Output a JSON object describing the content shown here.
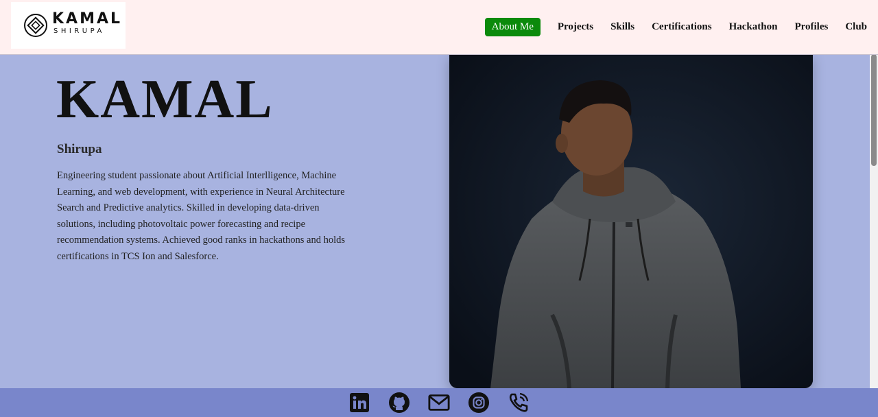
{
  "brand": {
    "name": "KAMAL",
    "tagline": "SHIRUPA",
    "emblem_icon": "diamond-emblem-icon"
  },
  "nav": {
    "items": [
      {
        "label": "About Me",
        "active": true
      },
      {
        "label": "Projects",
        "active": false
      },
      {
        "label": "Skills",
        "active": false
      },
      {
        "label": "Certifications",
        "active": false
      },
      {
        "label": "Hackathon",
        "active": false
      },
      {
        "label": "Profiles",
        "active": false
      },
      {
        "label": "Club",
        "active": false
      }
    ],
    "active_color": "#0b8a0b"
  },
  "hero": {
    "title": "KAMAL",
    "subtitle": "Shirupa",
    "description": "Engineering student passionate about Artificial Interlligence, Machine Learning, and web development, with experience in Neural Architecture Search and Predictive analytics. Skilled in developing data-driven solutions, including photovoltaic power forecasting and recipe recommendation systems. Achieved good ranks in hackathons and holds certifications in TCS Ion and Salesforce."
  },
  "footer": {
    "social_icons": [
      "linkedin-icon",
      "github-icon",
      "mail-icon",
      "instagram-icon",
      "phone-icon"
    ]
  },
  "colors": {
    "header_bg": "#fff0f0",
    "page_bg": "#a8b3e0",
    "footer_bg": "#7986cb",
    "photo_bg": "#0f1520"
  }
}
